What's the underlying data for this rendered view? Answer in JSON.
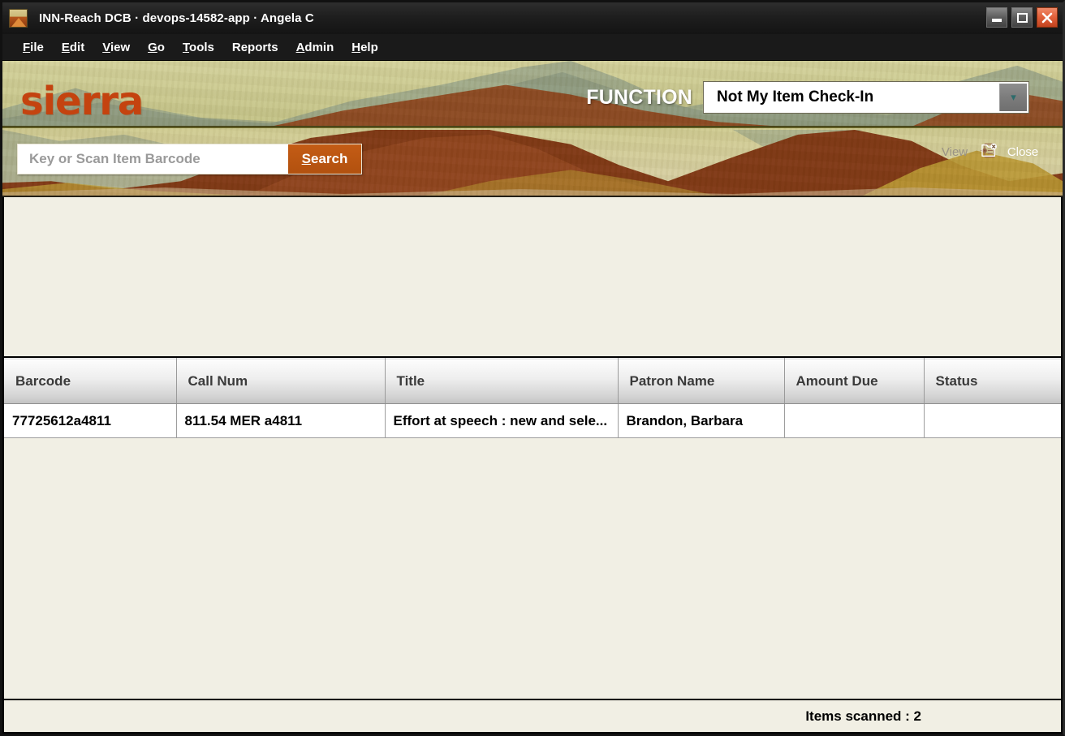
{
  "window": {
    "title": "INN-Reach DCB · devops-14582-app · Angela C",
    "app_icon": "mountain-icon",
    "controls": {
      "minimize": "minimize-icon",
      "maximize": "maximize-icon",
      "close": "close-icon"
    }
  },
  "menubar": {
    "items": [
      {
        "label": "File",
        "mnemonic": "F"
      },
      {
        "label": "Edit",
        "mnemonic": "E"
      },
      {
        "label": "View",
        "mnemonic": "V"
      },
      {
        "label": "Go",
        "mnemonic": "G"
      },
      {
        "label": "Tools",
        "mnemonic": "T"
      },
      {
        "label": "Reports",
        "mnemonic": "R"
      },
      {
        "label": "Admin",
        "mnemonic": "A"
      },
      {
        "label": "Help",
        "mnemonic": "H"
      }
    ]
  },
  "banner": {
    "logo": "sierra",
    "function_label": "FUNCTION",
    "function_value": "Not My Item Check-In",
    "function_arrow_icon": "chevron-down-icon",
    "search": {
      "placeholder": "Key or Scan Item Barcode",
      "value": "",
      "button_label": "Search",
      "button_mnemonic": "S"
    },
    "tools": [
      {
        "name": "view",
        "label": "View",
        "icon": "record-view-icon",
        "enabled": false
      },
      {
        "name": "close",
        "label": "Close",
        "icon": "folder-close-icon",
        "enabled": true
      }
    ]
  },
  "colors": {
    "accent_orange": "#b2510f",
    "logo_orange": "#c4430f",
    "banner_khaki": "#c9c98e",
    "banner_rust": "#8a3a11",
    "banner_gold": "#b8952e",
    "panel_cream": "#f1efe4",
    "titlebar_dark": "#1e1e1e",
    "close_red": "#e2623c"
  },
  "table": {
    "columns": [
      "Barcode",
      "Call Num",
      "Title",
      "Patron Name",
      "Amount Due",
      "Status"
    ],
    "rows": [
      {
        "barcode": "77725612a4811",
        "call_num": "811.54 MER  a4811",
        "title": "Effort at speech : new and sele...",
        "patron_name": "Brandon, Barbara",
        "amount_due": "",
        "status": ""
      }
    ]
  },
  "statusbar": {
    "text": "Items scanned : 2"
  }
}
